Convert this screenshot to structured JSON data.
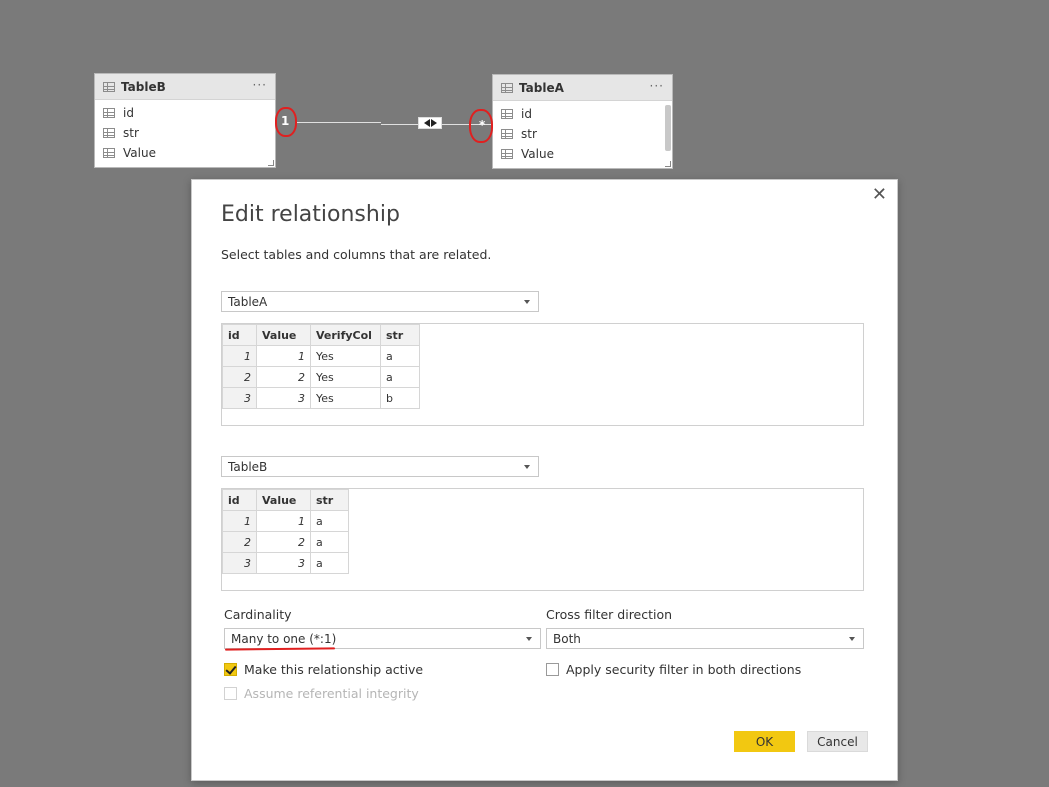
{
  "model": {
    "table_b": {
      "name": "TableB",
      "more": "···",
      "fields": [
        "id",
        "str",
        "Value"
      ]
    },
    "table_a": {
      "name": "TableA",
      "more": "···",
      "fields": [
        "id",
        "str",
        "Value"
      ]
    },
    "relationship": {
      "one_marker": "1",
      "many_marker": "*"
    }
  },
  "dialog": {
    "close": "✕",
    "title": "Edit relationship",
    "subtitle": "Select tables and columns that are related.",
    "table1": {
      "selected": "TableA",
      "columns": [
        "id",
        "Value",
        "VerifyCol",
        "str"
      ],
      "rows": [
        [
          "1",
          "1",
          "Yes",
          "a"
        ],
        [
          "2",
          "2",
          "Yes",
          "a"
        ],
        [
          "3",
          "3",
          "Yes",
          "b"
        ]
      ]
    },
    "table2": {
      "selected": "TableB",
      "columns": [
        "id",
        "Value",
        "str"
      ],
      "rows": [
        [
          "1",
          "1",
          "a"
        ],
        [
          "2",
          "2",
          "a"
        ],
        [
          "3",
          "3",
          "a"
        ]
      ]
    },
    "cardinality": {
      "label": "Cardinality",
      "value": "Many to one (*:1)"
    },
    "cross_filter": {
      "label": "Cross filter direction",
      "value": "Both"
    },
    "make_active": {
      "label": "Make this relationship active",
      "checked": true
    },
    "security_filter": {
      "label": "Apply security filter in both directions",
      "checked": false
    },
    "referential": {
      "label": "Assume referential integrity",
      "checked": false,
      "disabled": true
    },
    "ok_label": "OK",
    "cancel_label": "Cancel"
  },
  "colors": {
    "accent": "#f2c811",
    "annotation": "#e02020",
    "canvas": "#7a7a7a"
  }
}
